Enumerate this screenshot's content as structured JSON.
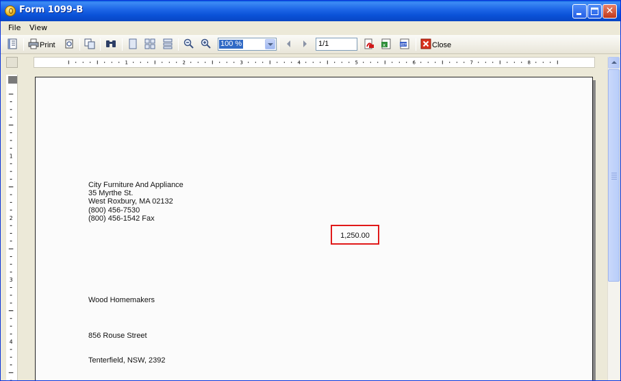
{
  "window": {
    "title": "Form 1099-B"
  },
  "menu": {
    "file": "File",
    "view": "View"
  },
  "toolbar": {
    "print_label": "Print",
    "zoom_value": "100 %",
    "page_value": "1/1",
    "close_label": "Close",
    "icons": [
      "toc-icon",
      "print-icon",
      "page-setup-icon",
      "copy-icon",
      "find-icon",
      "single-page-icon",
      "multi-page-icon",
      "continuous-icon",
      "zoom-out-icon",
      "zoom-in-icon",
      "prev-page-icon",
      "next-page-icon",
      "export-pdf-icon",
      "export-excel-icon",
      "export-rtf-icon",
      "close-icon"
    ]
  },
  "ruler": {
    "h_numbers": [
      "1",
      "2",
      "3",
      "4",
      "5",
      "6",
      "7",
      "8"
    ],
    "v_numbers": [
      "1",
      "2",
      "3",
      "4"
    ]
  },
  "document": {
    "sender": {
      "name": "City Furniture And Appliance",
      "street": "35 Myrthe St.",
      "city": "West Roxbury,  MA  02132",
      "phone": "(800) 456-7530",
      "fax": "(800) 456-1542 Fax"
    },
    "amount": "1,250.00",
    "recipient": {
      "name": "Wood Homemakers",
      "street": "856 Rouse Street",
      "city": "Tenterfield, NSW, 2392"
    }
  },
  "colors": {
    "title_blue": "#0a52d8",
    "highlight_red": "#e01818",
    "selection_blue": "#316ac5"
  }
}
